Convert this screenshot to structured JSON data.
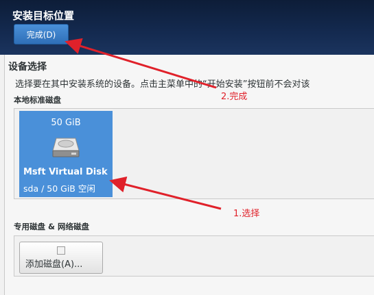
{
  "header": {
    "title": "安装目标位置",
    "done_label": "完成(D)"
  },
  "device_selection": {
    "title": "设备选择",
    "description": "选择要在其中安装系统的设备。点击主菜单中的“开始安装”按钮前不会对该",
    "local_disks_label": "本地标准磁盘",
    "disks": [
      {
        "size": "50 GiB",
        "name": "Msft Virtual Disk",
        "info": "sda / 50 GiB 空闲",
        "selected": true
      }
    ]
  },
  "specialized": {
    "label": "专用磁盘 & 网络磁盘",
    "add_disk_label": "添加磁盘(A)..."
  },
  "annotations": {
    "step1": "1.选择",
    "step2": "2.完成",
    "color": "#e0212a"
  },
  "colors": {
    "header_bg": "#142a50",
    "accent": "#4a90d9"
  }
}
